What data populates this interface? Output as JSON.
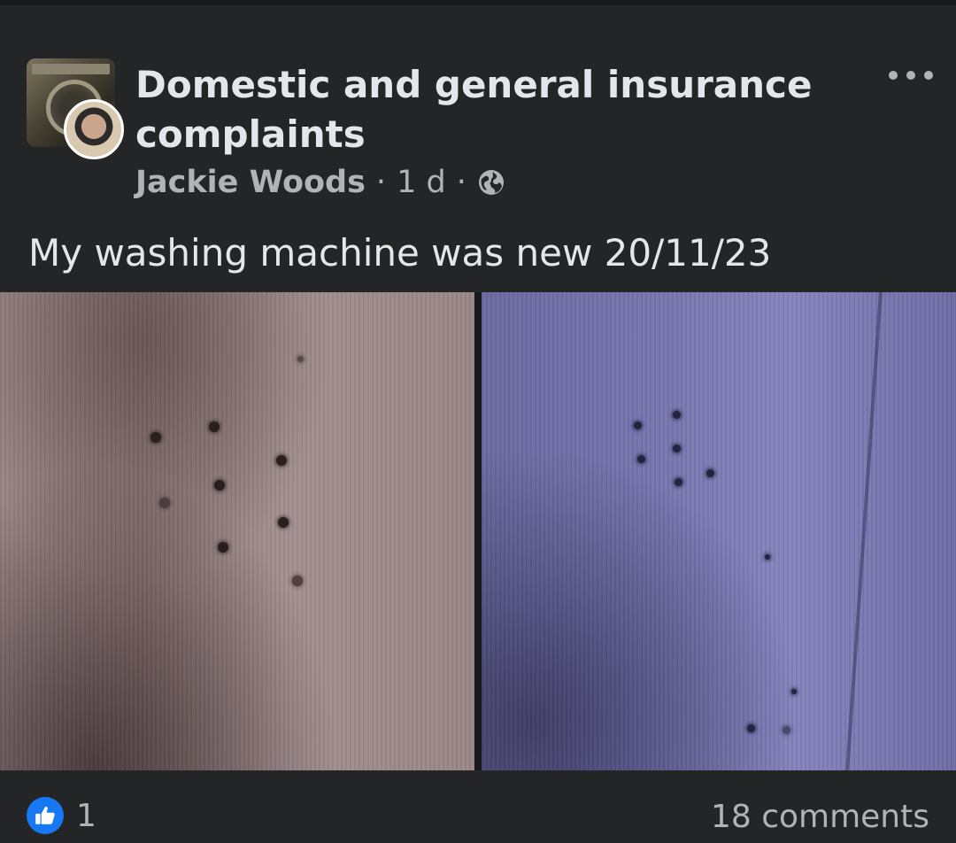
{
  "post": {
    "group_name": "Domestic and general insurance complaints",
    "author": "Jackie Woods",
    "time": "1 d",
    "separator": "·",
    "audience_icon": "globe-icon",
    "more_icon": "more-dots-icon",
    "text": "My washing machine was new 20/11/23"
  },
  "footer": {
    "like_icon": "like-thumb-icon",
    "like_count": "1",
    "comments": "18 comments"
  },
  "colors": {
    "background": "#242526",
    "text_primary": "#e4e6eb",
    "text_secondary": "#b0b3b8",
    "like_blue": "#1877f2"
  }
}
